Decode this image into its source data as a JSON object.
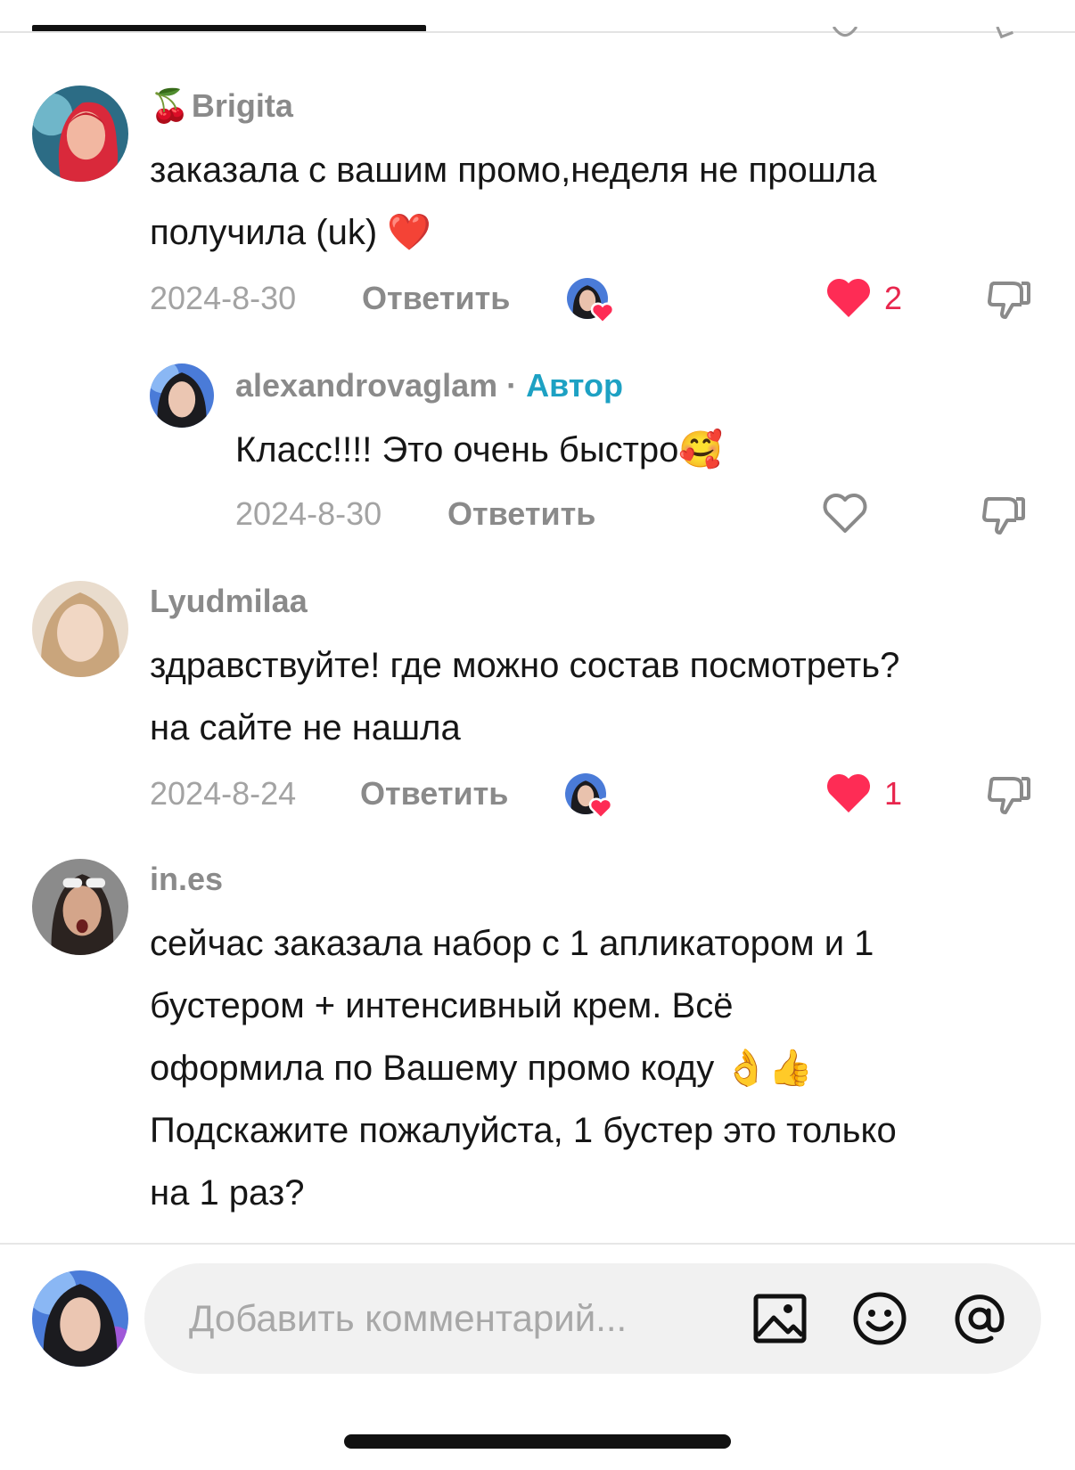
{
  "comments": [
    {
      "username": "Brigita",
      "username_prefix_emoji": "🍒",
      "text_lines": [
        "заказала с вашим промо,неделя не прошла",
        "получила (uk) ❤️"
      ],
      "date": "2024-8-30",
      "reply_label": "Ответить",
      "likes": "2",
      "liked": true,
      "author_liked": true
    },
    {
      "is_reply": true,
      "username": "alexandrovaglam",
      "separator": "·",
      "author_badge": "Автор",
      "text_lines": [
        "Класс!!!! Это очень быстро🥰"
      ],
      "date": "2024-8-30",
      "reply_label": "Ответить",
      "liked": false
    },
    {
      "username": "Lyudmilaa",
      "text_lines": [
        "здравствуйте! где можно состав посмотреть?",
        "на сайте не нашла"
      ],
      "date": "2024-8-24",
      "reply_label": "Ответить",
      "likes": "1",
      "liked": true,
      "author_liked": true
    },
    {
      "username": "in.es",
      "text_lines": [
        "сейчас заказала набор с 1 апликатором и 1",
        "бустером + интенсивный крем. Всё",
        "оформила по Вашему промо коду 👌👍",
        "Подскажите пожалуйста, 1 бустер это только",
        "на 1 раз?"
      ]
    }
  ],
  "composer": {
    "placeholder": "Добавить комментарий...",
    "icons": [
      "image-icon",
      "emoji-icon",
      "mention-icon"
    ]
  },
  "colors": {
    "like_red": "#fe2c55",
    "author_blue": "#1da1c3",
    "meta_gray": "#8a8a8a"
  }
}
